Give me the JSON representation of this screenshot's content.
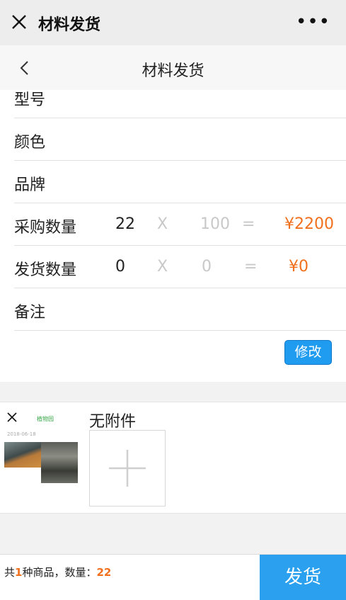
{
  "topbar": {
    "title": "材料发货",
    "more": "•••"
  },
  "navbar": {
    "title": "材料发货"
  },
  "form": {
    "rows": [
      {
        "label": "型号"
      },
      {
        "label": "颜色"
      },
      {
        "label": "品牌"
      },
      {
        "label": "采购数量",
        "qty": "22",
        "op_x": "X",
        "price": "100",
        "op_eq": "=",
        "total": "¥2200"
      },
      {
        "label": "发货数量",
        "qty": "0",
        "op_x": "X",
        "price": "0",
        "op_eq": "=",
        "total": "¥0"
      },
      {
        "label": "备注"
      }
    ],
    "edit_label": "修改"
  },
  "attachments": {
    "thumb_title": "植物园",
    "thumb_date": "2018-06-18",
    "none_label": "无附件"
  },
  "footer": {
    "prefix": "共",
    "kinds": "1",
    "mid": "种商品，数量：",
    "qty": "22",
    "ship_label": "发货"
  },
  "colors": {
    "accent": "#f0701e",
    "button_blue": "#1f9cf0",
    "ship_blue": "#2aa0ee"
  }
}
